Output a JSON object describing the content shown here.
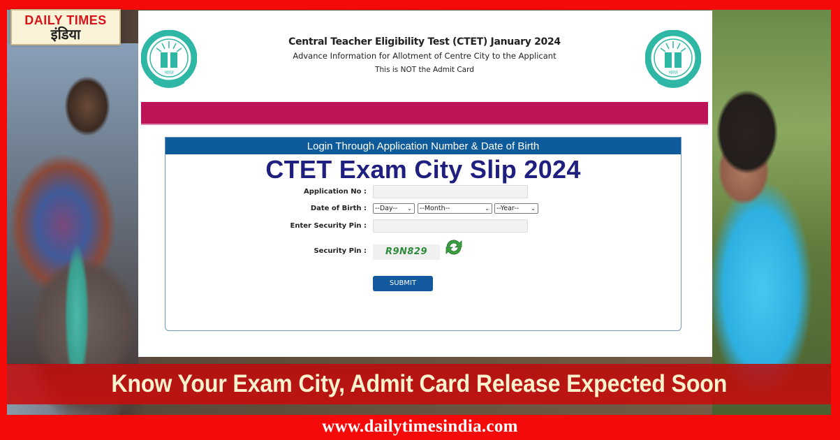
{
  "brand": {
    "logo_en": "DAILY TIMES",
    "logo_hi": "इंडिया",
    "website": "www.dailytimesindia.com",
    "accent_color": "#f50a0a"
  },
  "screenshot": {
    "emblem_left": "cbse-emblem-icon",
    "emblem_right": "cbse-emblem-icon",
    "title": "Central Teacher Eligibility Test (CTET) January 2024",
    "subtitle": "Advance Information for Allotment of Centre City to the Applicant",
    "note": "This is NOT the Admit Card",
    "band_color": "#bd1458",
    "login": {
      "header": "Login Through Application Number & Date of Birth",
      "overlay_title": "CTET Exam City Slip 2024",
      "fields": {
        "application_no_label": "Application No :",
        "application_no_value": "",
        "dob_label": "Date of Birth :",
        "dob_day": "--Day--",
        "dob_month": "--Month--",
        "dob_year": "--Year--",
        "security_pin_input_label": "Enter Security Pin :",
        "security_pin_input_value": "",
        "security_pin_label": "Security Pin :",
        "captcha_text": "R9N829"
      },
      "submit_label": "SUBMIT",
      "header_color": "#0e5b9c"
    }
  },
  "headline": "Know Your Exam City, Admit Card Release Expected Soon"
}
